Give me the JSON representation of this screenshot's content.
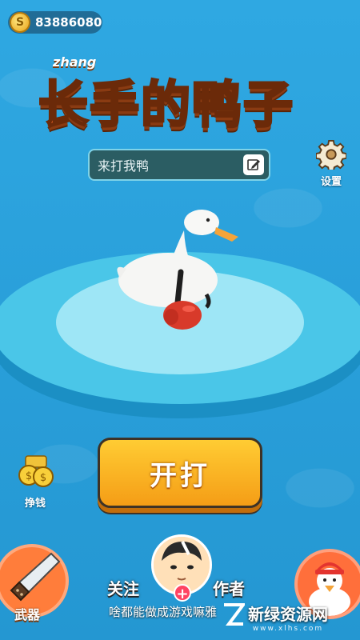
{
  "coins": {
    "value": "83886080",
    "icon_letter": "S"
  },
  "title": {
    "tag": "zhang",
    "text": "长手的鸭子"
  },
  "name_field": {
    "value": "来打我鸭"
  },
  "settings": {
    "label": "设置"
  },
  "start_button": {
    "label": "开打"
  },
  "earn": {
    "label": "挣钱"
  },
  "weapon": {
    "label": "武器"
  },
  "follow": {
    "follow_label": "关注",
    "author_label": "作者",
    "plus": "+",
    "subtitle": "啥都能做成游戏嘛雅"
  },
  "watermark": {
    "title": "新绿资源网",
    "url": "www.xlhs.com"
  },
  "colors": {
    "background": "#2aa3dd",
    "button": "#f8b21e",
    "accent": "#ff6b2c"
  }
}
